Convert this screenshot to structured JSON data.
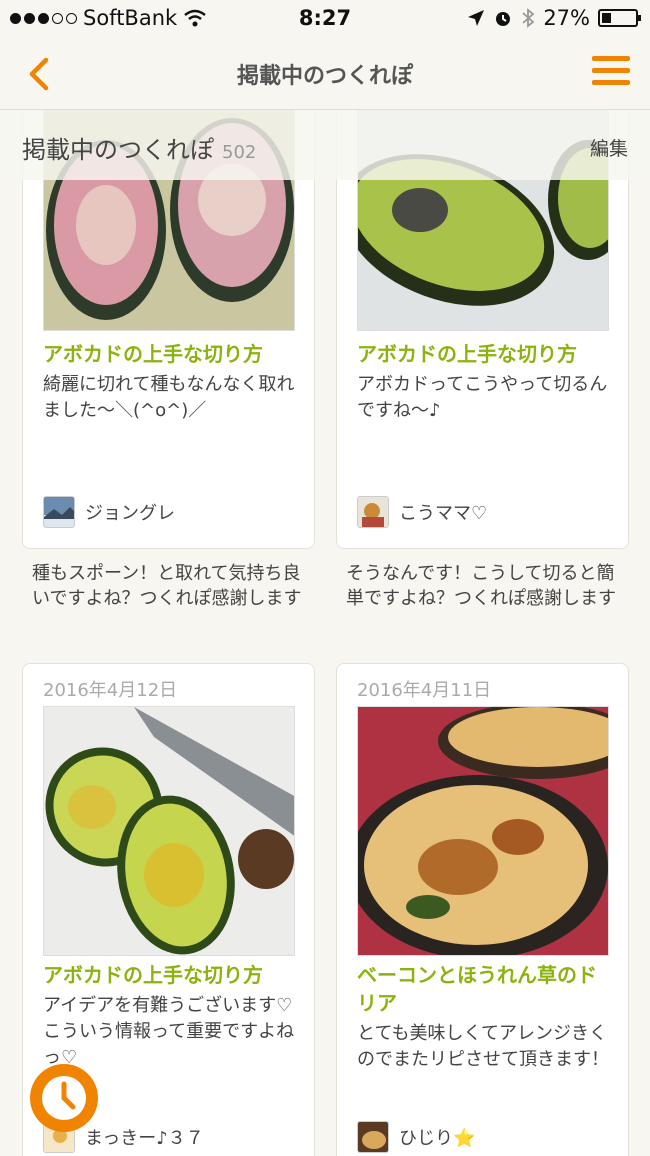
{
  "status_bar": {
    "carrier": "SoftBank",
    "time": "8:27",
    "battery": "27%",
    "battery_level": 0.27
  },
  "nav": {
    "title": "掲載中のつくれぽ"
  },
  "section": {
    "title": "掲載中のつくれぽ",
    "count": "502",
    "edit_label": "編集"
  },
  "cards": [
    {
      "date": "",
      "title": "アボカドの上手な切り方",
      "text": "綺麗に切れて種もなんなく取れました〜＼(^o^)／",
      "author": "ジョングレ",
      "reply": "種もスポーン！と取れて気持ち良いですよね？つくれぽ感謝します"
    },
    {
      "date": "",
      "title": "アボカドの上手な切り方",
      "text": "アボカドってこうやって切るんですね〜♪",
      "author": "こうママ♡",
      "reply": "そうなんです！こうして切ると簡単ですよね？つくれぽ感謝します"
    },
    {
      "date": "2016年4月12日",
      "title": "アボカドの上手な切り方",
      "text": "アイデアを有難うございます♡こういう情報って重要ですよねっ♡",
      "author": "まっきー♪３７",
      "reply": ""
    },
    {
      "date": "2016年4月11日",
      "title": "ベーコンとほうれん草のドリア",
      "text": "とても美味しくてアレンジきくのでまたリピさせて頂きます！",
      "author": "ひじり⭐",
      "reply": ""
    }
  ],
  "colors": {
    "accent": "#f08300",
    "title_green": "#8cb30d",
    "background": "#f7f6f0"
  },
  "icons": {
    "back": "chevron-left-icon",
    "menu": "hamburger-icon",
    "history": "clock-icon"
  }
}
